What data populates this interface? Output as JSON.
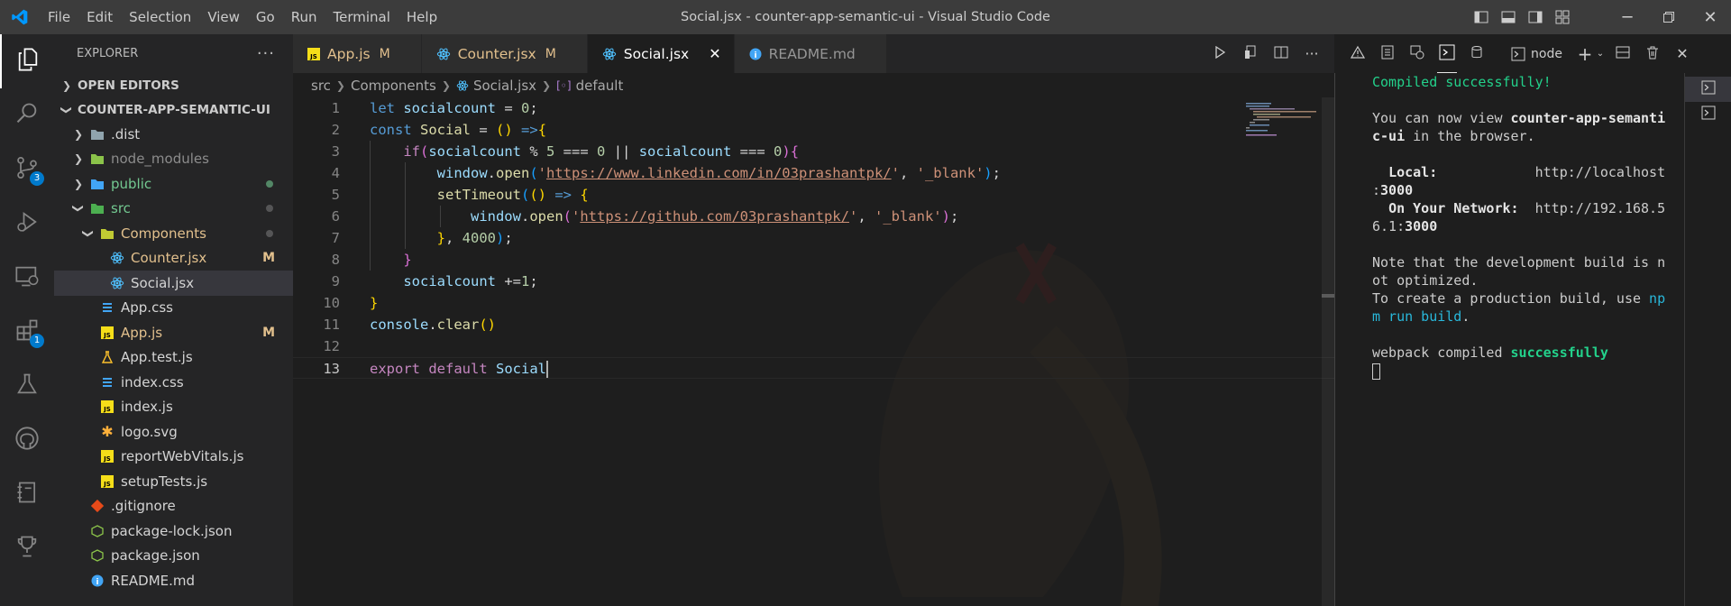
{
  "window": {
    "title": "Social.jsx - counter-app-semantic-ui - Visual Studio Code",
    "menu": [
      "File",
      "Edit",
      "Selection",
      "View",
      "Go",
      "Run",
      "Terminal",
      "Help"
    ]
  },
  "activity_bar": {
    "items": [
      {
        "icon": "files-icon",
        "badge": ""
      },
      {
        "icon": "search-icon",
        "badge": ""
      },
      {
        "icon": "source-control-icon",
        "badge": "3"
      },
      {
        "icon": "run-debug-icon",
        "badge": ""
      },
      {
        "icon": "remote-explorer-icon",
        "badge": ""
      },
      {
        "icon": "extensions-icon",
        "badge": "1"
      },
      {
        "icon": "testing-icon",
        "badge": ""
      },
      {
        "icon": "github-icon",
        "badge": ""
      },
      {
        "icon": "notebook-icon",
        "badge": ""
      },
      {
        "icon": "trophy-icon",
        "badge": ""
      }
    ]
  },
  "explorer": {
    "title": "EXPLORER",
    "open_editors": "OPEN EDITORS",
    "project": "COUNTER-APP-SEMANTIC-UI",
    "tree": [
      {
        "name": ".dist",
        "type": "folder",
        "indent": 1,
        "expanded": false,
        "color": "plain",
        "badge": "",
        "dot": ""
      },
      {
        "name": "node_modules",
        "type": "folder-green",
        "indent": 1,
        "expanded": false,
        "color": "dim",
        "badge": "",
        "dot": ""
      },
      {
        "name": "public",
        "type": "folder-blue",
        "indent": 1,
        "expanded": false,
        "color": "grn",
        "badge": "",
        "dot": "green"
      },
      {
        "name": "src",
        "type": "folder-src",
        "indent": 1,
        "expanded": true,
        "color": "grn",
        "badge": "",
        "dot": "gray"
      },
      {
        "name": "Components",
        "type": "folder-open",
        "indent": 2,
        "expanded": true,
        "color": "mod",
        "badge": "",
        "dot": "gray"
      },
      {
        "name": "Counter.jsx",
        "type": "react",
        "indent": 3,
        "expanded": null,
        "color": "mod",
        "badge": "M",
        "dot": ""
      },
      {
        "name": "Social.jsx",
        "type": "react",
        "indent": 3,
        "expanded": null,
        "color": "plain",
        "badge": "",
        "dot": "",
        "selected": true
      },
      {
        "name": "App.css",
        "type": "css",
        "indent": 2,
        "expanded": null,
        "color": "plain",
        "badge": "",
        "dot": ""
      },
      {
        "name": "App.js",
        "type": "js",
        "indent": 2,
        "expanded": null,
        "color": "mod",
        "badge": "M",
        "dot": ""
      },
      {
        "name": "App.test.js",
        "type": "test",
        "indent": 2,
        "expanded": null,
        "color": "plain",
        "badge": "",
        "dot": ""
      },
      {
        "name": "index.css",
        "type": "css",
        "indent": 2,
        "expanded": null,
        "color": "plain",
        "badge": "",
        "dot": ""
      },
      {
        "name": "index.js",
        "type": "js",
        "indent": 2,
        "expanded": null,
        "color": "plain",
        "badge": "",
        "dot": ""
      },
      {
        "name": "logo.svg",
        "type": "svg",
        "indent": 2,
        "expanded": null,
        "color": "plain",
        "badge": "",
        "dot": ""
      },
      {
        "name": "reportWebVitals.js",
        "type": "js",
        "indent": 2,
        "expanded": null,
        "color": "plain",
        "badge": "",
        "dot": ""
      },
      {
        "name": "setupTests.js",
        "type": "js",
        "indent": 2,
        "expanded": null,
        "color": "plain",
        "badge": "",
        "dot": ""
      },
      {
        "name": ".gitignore",
        "type": "git",
        "indent": 1,
        "expanded": null,
        "color": "plain",
        "badge": "",
        "dot": ""
      },
      {
        "name": "package-lock.json",
        "type": "json",
        "indent": 1,
        "expanded": null,
        "color": "plain",
        "badge": "",
        "dot": ""
      },
      {
        "name": "package.json",
        "type": "json",
        "indent": 1,
        "expanded": null,
        "color": "plain",
        "badge": "",
        "dot": ""
      },
      {
        "name": "README.md",
        "type": "info",
        "indent": 1,
        "expanded": null,
        "color": "plain",
        "badge": "",
        "dot": ""
      }
    ]
  },
  "tabs": [
    {
      "label": "App.js",
      "icon": "js",
      "modified": "M",
      "active": false
    },
    {
      "label": "Counter.jsx",
      "icon": "react",
      "modified": "M",
      "active": false
    },
    {
      "label": "Social.jsx",
      "icon": "react",
      "modified": "",
      "active": true
    },
    {
      "label": "README.md",
      "icon": "info",
      "modified": "",
      "active": false
    }
  ],
  "breadcrumb": {
    "parts": [
      "src",
      "Components",
      "Social.jsx",
      "default"
    ]
  },
  "editor": {
    "current_line": 13,
    "lines": [
      [
        [
          "kw",
          "let"
        ],
        [
          "plain",
          " "
        ],
        [
          "var",
          "socialcount"
        ],
        [
          "plain",
          " = "
        ],
        [
          "num",
          "0"
        ],
        [
          "plain",
          ";"
        ]
      ],
      [
        [
          "kw",
          "const"
        ],
        [
          "plain",
          " "
        ],
        [
          "fn",
          "Social"
        ],
        [
          "plain",
          " = "
        ],
        [
          "p1",
          "()"
        ],
        [
          "plain",
          " "
        ],
        [
          "kw",
          "=>"
        ],
        [
          "p1",
          "{"
        ]
      ],
      [
        [
          "plain",
          "    "
        ],
        [
          "kw2",
          "if"
        ],
        [
          "p2",
          "("
        ],
        [
          "var",
          "socialcount"
        ],
        [
          "plain",
          " % "
        ],
        [
          "num",
          "5"
        ],
        [
          "plain",
          " === "
        ],
        [
          "num",
          "0"
        ],
        [
          "plain",
          " || "
        ],
        [
          "var",
          "socialcount"
        ],
        [
          "plain",
          " === "
        ],
        [
          "num",
          "0"
        ],
        [
          "p2",
          ")"
        ],
        [
          "p2",
          "{"
        ]
      ],
      [
        [
          "plain",
          "        "
        ],
        [
          "var",
          "window"
        ],
        [
          "plain",
          "."
        ],
        [
          "fn",
          "open"
        ],
        [
          "p3",
          "("
        ],
        [
          "str",
          "'"
        ],
        [
          "url",
          "https://www.linkedin.com/in/03prashantpk/"
        ],
        [
          "str",
          "'"
        ],
        [
          "plain",
          ", "
        ],
        [
          "str",
          "'_blank'"
        ],
        [
          "p3",
          ")"
        ],
        [
          "plain",
          ";"
        ]
      ],
      [
        [
          "plain",
          "        "
        ],
        [
          "fn",
          "setTimeout"
        ],
        [
          "p3",
          "("
        ],
        [
          "p1",
          "()"
        ],
        [
          "plain",
          " "
        ],
        [
          "kw",
          "=>"
        ],
        [
          "plain",
          " "
        ],
        [
          "p1",
          "{"
        ]
      ],
      [
        [
          "plain",
          "            "
        ],
        [
          "var",
          "window"
        ],
        [
          "plain",
          "."
        ],
        [
          "fn",
          "open"
        ],
        [
          "p2",
          "("
        ],
        [
          "str",
          "'"
        ],
        [
          "url",
          "https://github.com/03prashantpk/"
        ],
        [
          "str",
          "'"
        ],
        [
          "plain",
          ", "
        ],
        [
          "str",
          "'_blank'"
        ],
        [
          "p2",
          ")"
        ],
        [
          "plain",
          ";"
        ]
      ],
      [
        [
          "plain",
          "        "
        ],
        [
          "p1",
          "}"
        ],
        [
          "plain",
          ", "
        ],
        [
          "num",
          "4000"
        ],
        [
          "p3",
          ")"
        ],
        [
          "plain",
          ";"
        ]
      ],
      [
        [
          "plain",
          "    "
        ],
        [
          "p2",
          "}"
        ]
      ],
      [
        [
          "plain",
          "    "
        ],
        [
          "var",
          "socialcount"
        ],
        [
          "plain",
          " +="
        ],
        [
          "num",
          "1"
        ],
        [
          "plain",
          ";"
        ]
      ],
      [
        [
          "p1",
          "}"
        ]
      ],
      [
        [
          "var",
          "console"
        ],
        [
          "plain",
          "."
        ],
        [
          "fn",
          "clear"
        ],
        [
          "p1",
          "()"
        ]
      ],
      [],
      [
        [
          "kw2",
          "export"
        ],
        [
          "plain",
          " "
        ],
        [
          "kw2",
          "default"
        ],
        [
          "plain",
          " "
        ],
        [
          "var",
          "Social"
        ]
      ]
    ]
  },
  "panel": {
    "terminal_name": "node",
    "output": [
      [
        [
          "t-green",
          "Compiled successfully!"
        ]
      ],
      [],
      [
        [
          "plain",
          "You can now view "
        ],
        [
          "t-bold",
          "counter-app-semanti"
        ]
      ],
      [
        [
          "t-bold",
          "c-ui"
        ],
        [
          "plain",
          " in the browser."
        ]
      ],
      [],
      [
        [
          "plain",
          "  "
        ],
        [
          "t-bold",
          "Local:"
        ],
        [
          "plain",
          "            http://localhost"
        ]
      ],
      [
        [
          "plain",
          ":"
        ],
        [
          "t-bold",
          "3000"
        ]
      ],
      [
        [
          "plain",
          "  "
        ],
        [
          "t-bold",
          "On Your Network:"
        ],
        [
          "plain",
          "  http://192.168.5"
        ]
      ],
      [
        [
          "plain",
          "6.1:"
        ],
        [
          "t-bold",
          "3000"
        ]
      ],
      [],
      [
        [
          "plain",
          "Note that the development build is n"
        ]
      ],
      [
        [
          "plain",
          "ot optimized."
        ]
      ],
      [
        [
          "plain",
          "To create a production build, use "
        ],
        [
          "t-blue",
          "np"
        ]
      ],
      [
        [
          "t-blue",
          "m run build"
        ],
        [
          "plain",
          "."
        ]
      ],
      [],
      [
        [
          "plain",
          "webpack compiled "
        ],
        [
          "t-green t-boldg",
          "successfully"
        ]
      ]
    ]
  },
  "colors": {
    "accent": "#007acc",
    "title_bar": "#3c3c3c",
    "sidebar": "#252526",
    "editor": "#1e1e1e",
    "modified": "#e2c08d",
    "untracked": "#73c991"
  }
}
